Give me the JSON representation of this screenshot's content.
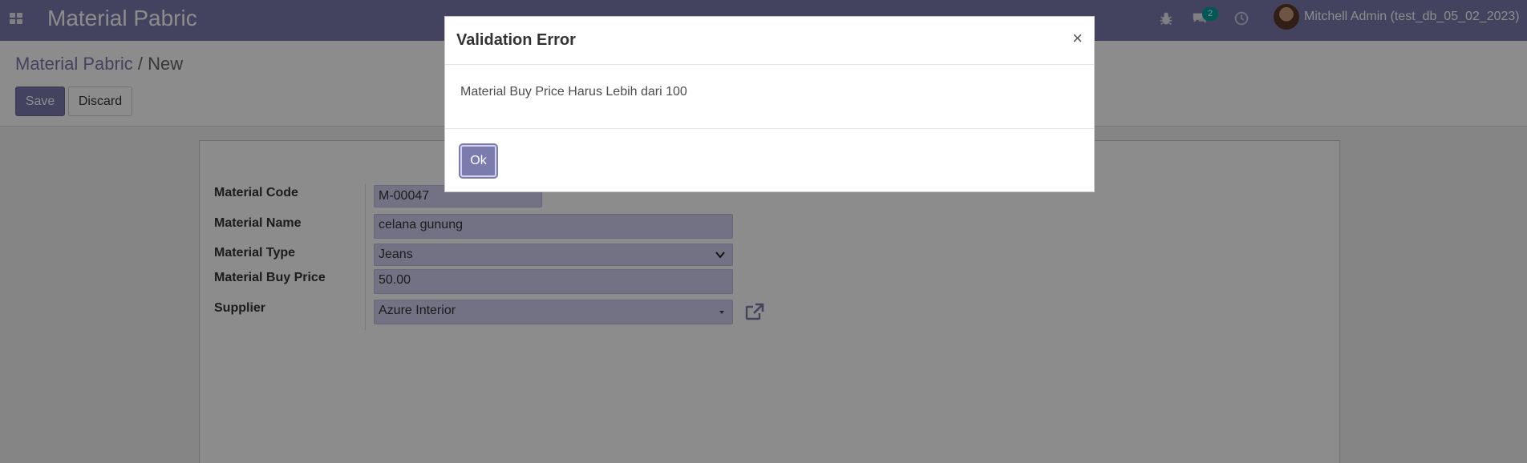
{
  "navbar": {
    "brand": "Material Pabric",
    "messages_badge": "2",
    "user_name": "Mitchell Admin (test_db_05_02_2023)",
    "icons": [
      "apps-icon",
      "bug-icon",
      "chat-icon",
      "clock-icon",
      "avatar"
    ]
  },
  "control_panel": {
    "breadcrumb_parent": "Material Pabric",
    "breadcrumb_separator": "/",
    "breadcrumb_current": "New",
    "save_label": "Save",
    "discard_label": "Discard"
  },
  "form": {
    "fields": [
      {
        "label": "Material Code",
        "value": "M-00047"
      },
      {
        "label": "Material Name",
        "value": "celana gunung"
      },
      {
        "label": "Material Type",
        "value": "Jeans"
      },
      {
        "label": "Material Buy Price",
        "value": "50.00"
      },
      {
        "label": "Supplier",
        "value": "Azure Interior"
      }
    ]
  },
  "dialog": {
    "title": "Validation Error",
    "close_glyph": "×",
    "message": "Material Buy Price Harus Lebih dari 100",
    "ok_label": "Ok"
  },
  "colors": {
    "brand": "#7c7bad",
    "field_bg": "#d2d0f0",
    "badge": "#00a09d"
  }
}
